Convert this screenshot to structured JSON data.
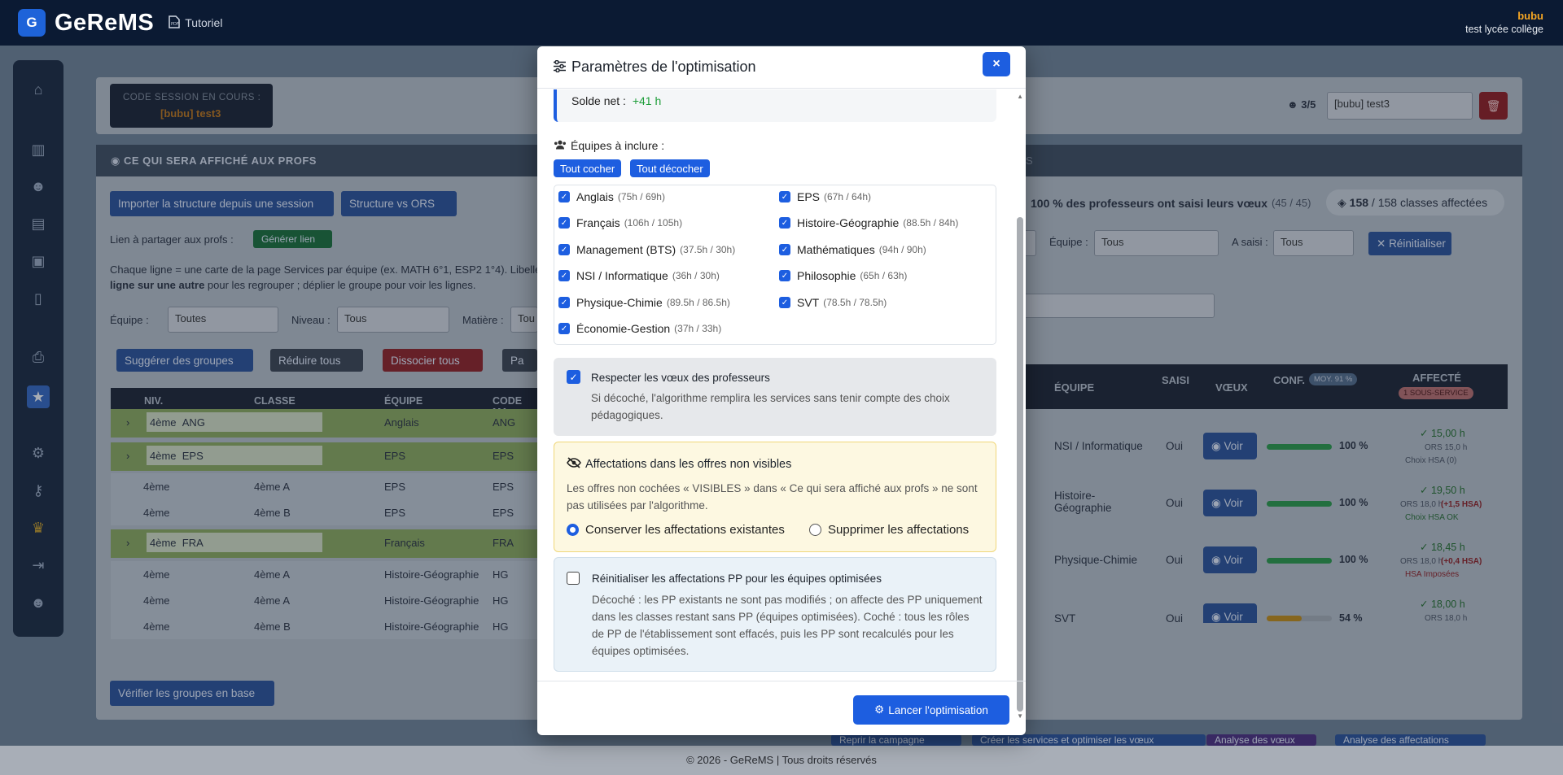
{
  "topbar": {
    "logo_letter": "G",
    "brand": "GeReMS",
    "tutorial": "Tutoriel",
    "user_name": "bubu",
    "user_school": "test lycée collège"
  },
  "background": {
    "session_label": "CODE SESSION EN COURS :",
    "session_value": "[bubu] test3",
    "session_select": "[bubu] test3",
    "session_count": "3/5",
    "panel_title": "CE QUI SERA AFFICHÉ AUX PROFS",
    "import_btn": "Importer la structure depuis une session",
    "ors_btn": "Structure vs ORS",
    "share_label": "Lien à partager aux profs :",
    "generate_link": "Générer lien",
    "help_line1": "Chaque ligne = une carte de la page Services par équipe (ex. MATH 6°1, ESP2 1°4). Libellé et vis",
    "help_line2_bold": "ligne sur une autre",
    "help_line2": " pour les regrouper ; déplier le groupe pour voir les lignes.",
    "filter_equipe": "Équipe :",
    "filter_equipe_val": "Toutes",
    "filter_niveau": "Niveau :",
    "filter_niveau_val": "Tous",
    "filter_matiere": "Matière :",
    "filter_matiere_val": "Tou",
    "suggest_btn": "Suggérer des groupes",
    "reduce_btn": "Réduire tous",
    "dissoc_btn": "Dissocier tous",
    "extra_btn": "Pa",
    "columns": [
      "NIV.",
      "CLASSE",
      "ÉQUIPE",
      "CODE MA"
    ],
    "rows": [
      {
        "niv": "4ème",
        "group": "ANG",
        "equipe": "Anglais",
        "code": "ANG"
      },
      {
        "niv": "4ème",
        "group": "EPS",
        "equipe": "EPS",
        "code": "EPS"
      },
      {
        "niv": "4ème",
        "classe": "4ème A",
        "equipe": "EPS",
        "code": "EPS"
      },
      {
        "niv": "4ème",
        "classe": "4ème B",
        "equipe": "EPS",
        "code": "EPS"
      },
      {
        "niv": "4ème",
        "group": "FRA",
        "equipe": "Français",
        "code": "FRA"
      },
      {
        "niv": "4ème",
        "classe": "4ème A",
        "equipe": "Histoire-Géographie",
        "code": "HG"
      },
      {
        "niv": "4ème",
        "classe": "4ème A",
        "equipe": "Histoire-Géographie",
        "code": "HG"
      },
      {
        "niv": "4ème",
        "classe": "4ème B",
        "equipe": "Histoire-Géographie",
        "code": "HG"
      }
    ],
    "verify_btn": "Vérifier les groupes en base",
    "tab_s": "S",
    "saisi_text": "100 % des professeurs ont saisi leurs vœux",
    "saisi_count": "(45 / 45)",
    "classes_count": "158",
    "classes_text": "/ 158 classes affectées",
    "equipe_label": "Équipe :",
    "equipe_val": "Tous",
    "asaisi_label": "A saisi :",
    "asaisi_val": "Tous",
    "reset_btn": "Réinitialiser",
    "right_cols": [
      "ÉQUIPE",
      "SAISI",
      "VŒUX",
      "CONF.",
      "AFFECTÉ"
    ],
    "moy_badge": "MOY. 91 %",
    "sous_service": "1 SOUS-SERVICE",
    "prof_rows": [
      {
        "equipe": "NSI / Informatique",
        "saisi": "Oui",
        "voir": "Voir",
        "conf": "100 %",
        "affecte": "✓ 15,00 h",
        "ors": "ORS 15,0 h",
        "note": "Choix HSA (0)"
      },
      {
        "equipe": "Histoire-Géographie",
        "saisi": "Oui",
        "voir": "Voir",
        "conf": "100 %",
        "affecte": "✓ 19,50 h",
        "ors": "ORS 18,0 h",
        "extra": "(+1,5 HSA)",
        "note": "Choix HSA OK"
      },
      {
        "equipe": "Physique-Chimie",
        "saisi": "Oui",
        "voir": "Voir",
        "conf": "100 %",
        "affecte": "✓ 18,45 h",
        "ors": "ORS 18,0 h",
        "extra": "(+0,4 HSA)",
        "note": "HSA Imposées"
      },
      {
        "equipe": "SVT",
        "saisi": "Oui",
        "voir": "Voir",
        "conf": "54 %",
        "affecte": "✓ 18,00 h",
        "ors": "ORS 18,0 h"
      }
    ],
    "bottom_btns": [
      "Reprir la campagne",
      "Créer les services et optimiser les vœux",
      "Analyse des vœux",
      "Analyse des affectations"
    ]
  },
  "modal": {
    "title": "Paramètres de l'optimisation",
    "close": "×",
    "solde_label": "Solde net :",
    "solde_value": "+41 h",
    "teams_label": "Équipes à inclure :",
    "check_all": "Tout cocher",
    "uncheck_all": "Tout décocher",
    "teams": [
      {
        "name": "Anglais",
        "hours": "(75h / 69h)"
      },
      {
        "name": "EPS",
        "hours": "(67h / 64h)"
      },
      {
        "name": "Français",
        "hours": "(106h / 105h)"
      },
      {
        "name": "Histoire-Géographie",
        "hours": "(88.5h / 84h)"
      },
      {
        "name": "Management (BTS)",
        "hours": "(37.5h / 30h)"
      },
      {
        "name": "Mathématiques",
        "hours": "(94h / 90h)"
      },
      {
        "name": "NSI / Informatique",
        "hours": "(36h / 30h)"
      },
      {
        "name": "Philosophie",
        "hours": "(65h / 63h)"
      },
      {
        "name": "Physique-Chimie",
        "hours": "(89.5h / 86.5h)"
      },
      {
        "name": "SVT",
        "hours": "(78.5h / 78.5h)"
      },
      {
        "name": "Économie-Gestion",
        "hours": "(37h / 33h)"
      }
    ],
    "voeux_title": "Respecter les vœux des professeurs",
    "voeux_desc": "Si décoché, l'algorithme remplira les services sans tenir compte des choix pédagogiques.",
    "hidden_title": "Affectations dans les offres non visibles",
    "hidden_desc": "Les offres non cochées « VISIBLES » dans « Ce qui sera affiché aux profs » ne sont pas utilisées par l'algorithme.",
    "radio_keep": "Conserver les affectations existantes",
    "radio_delete": "Supprimer les affectations",
    "pp_title": "Réinitialiser les affectations PP pour les équipes optimisées",
    "pp_desc": "Décoché : les PP existants ne sont pas modifiés ; on affecte des PP uniquement dans les classes restant sans PP (équipes optimisées). Coché : tous les rôles de PP de l'établissement sont effacés, puis les PP sont recalculés pour les équipes optimisées.",
    "launch": "Lancer l'optimisation"
  },
  "footer": {
    "text": "© 2026 - GeReMS | Tous droits réservés"
  },
  "colors": {
    "primary": "#1d5ee0",
    "success": "#1e9e3a",
    "warning_bg": "#fdf8e1",
    "info_bg": "#eaf2f8"
  }
}
